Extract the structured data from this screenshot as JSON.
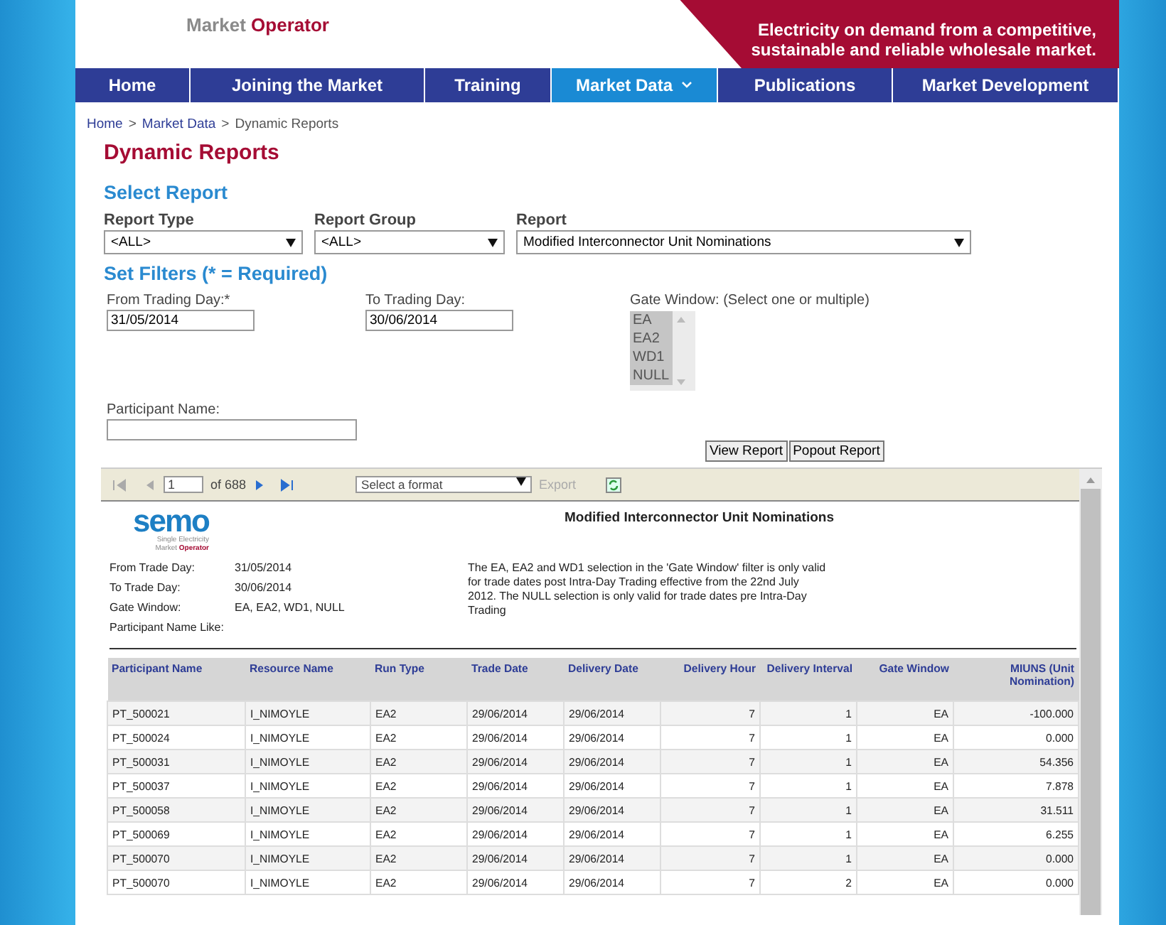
{
  "header": {
    "logo": {
      "first": "Market",
      "second": "Operator"
    },
    "banner": [
      "Electricity on demand from a competitive,",
      "sustainable and reliable wholesale market."
    ]
  },
  "nav": [
    {
      "label": "Home",
      "selected": false
    },
    {
      "label": "Joining the Market",
      "selected": false
    },
    {
      "label": "Training",
      "selected": false
    },
    {
      "label": "Market Data",
      "selected": true,
      "dropdown": true
    },
    {
      "label": "Publications",
      "selected": false
    },
    {
      "label": "Market Development",
      "selected": false
    }
  ],
  "breadcrumb": [
    "Home",
    "Market Data",
    "Dynamic Reports"
  ],
  "breadcrumb_separator": ">",
  "title": "Dynamic Reports",
  "select_report": {
    "heading": "Select Report",
    "fields": [
      {
        "label": "Report Type",
        "value": "<ALL>"
      },
      {
        "label": "Report Group",
        "value": "<ALL>"
      },
      {
        "label": "Report",
        "value": "Modified Interconnector Unit Nominations"
      }
    ]
  },
  "filters": {
    "heading": "Set Filters (* = Required)",
    "from": {
      "label": "From Trading Day:*",
      "value": "31/05/2014"
    },
    "to": {
      "label": "To Trading Day:",
      "value": "30/06/2014"
    },
    "gate_window": {
      "label": "Gate Window: (Select one or multiple)",
      "options": [
        {
          "label": "EA",
          "selected": true
        },
        {
          "label": "EA2",
          "selected": true
        },
        {
          "label": "WD1",
          "selected": true
        },
        {
          "label": "NULL",
          "selected": true
        }
      ]
    },
    "participant": {
      "label": "Participant Name:"
    },
    "buttons": [
      "View Report",
      "Popout Report"
    ]
  },
  "viewer": {
    "toolbar": {
      "page": "1",
      "of": "of 688",
      "format": "Select a format",
      "export": "Export"
    },
    "logo": {
      "word": "semo",
      "line1": "Single Electricity",
      "line2_first": "Market",
      "line2_second": "Operator"
    },
    "report_title": "Modified Interconnector Unit Nominations",
    "params": [
      {
        "label": "From Trade Day:",
        "value": "31/05/2014"
      },
      {
        "label": "To Trade Day:",
        "value": "30/06/2014"
      },
      {
        "label": "Gate Window:",
        "value": "EA, EA2, WD1, NULL"
      },
      {
        "label": "Participant Name Like:"
      }
    ],
    "note": "The EA, EA2 and WD1 selection in the 'Gate Window' filter is only valid for trade dates post Intra-Day Trading effective from the 22nd July 2012. The NULL selection is only valid for trade dates pre Intra-Day Trading",
    "table": {
      "columns": [
        "Participant Name",
        "Resource Name",
        "Run Type",
        "Trade Date",
        "Delivery Date",
        "Delivery Hour",
        "Delivery Interval",
        "Gate Window",
        "MIUNS (Unit Nomination)"
      ],
      "rows": [
        [
          "PT_500021",
          "I_NIMOYLE",
          "EA2",
          "29/06/2014",
          "29/06/2014",
          "7",
          "1",
          "EA",
          "-100.000"
        ],
        [
          "PT_500024",
          "I_NIMOYLE",
          "EA2",
          "29/06/2014",
          "29/06/2014",
          "7",
          "1",
          "EA",
          "0.000"
        ],
        [
          "PT_500031",
          "I_NIMOYLE",
          "EA2",
          "29/06/2014",
          "29/06/2014",
          "7",
          "1",
          "EA",
          "54.356"
        ],
        [
          "PT_500037",
          "I_NIMOYLE",
          "EA2",
          "29/06/2014",
          "29/06/2014",
          "7",
          "1",
          "EA",
          "7.878"
        ],
        [
          "PT_500058",
          "I_NIMOYLE",
          "EA2",
          "29/06/2014",
          "29/06/2014",
          "7",
          "1",
          "EA",
          "31.511"
        ],
        [
          "PT_500069",
          "I_NIMOYLE",
          "EA2",
          "29/06/2014",
          "29/06/2014",
          "7",
          "1",
          "EA",
          "6.255"
        ],
        [
          "PT_500070",
          "I_NIMOYLE",
          "EA2",
          "29/06/2014",
          "29/06/2014",
          "7",
          "1",
          "EA",
          "0.000"
        ],
        [
          "PT_500070",
          "I_NIMOYLE",
          "EA2",
          "29/06/2014",
          "29/06/2014",
          "7",
          "2",
          "EA",
          "0.000"
        ]
      ]
    }
  }
}
